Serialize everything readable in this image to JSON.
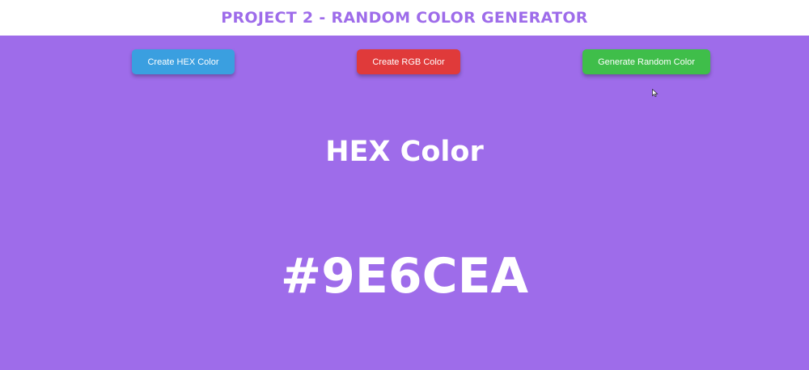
{
  "header": {
    "title": "PROJECT 2 - RANDOM COLOR GENERATOR"
  },
  "colors": {
    "background": "#9E6CEA",
    "header_bg": "#FFFFFF",
    "title_text": "#9E6CEA",
    "hex_button": "#3A9FE0",
    "rgb_button": "#E03A3A",
    "random_button": "#3FBE4A"
  },
  "buttons": {
    "hex_label": "Create HEX Color",
    "rgb_label": "Create RGB Color",
    "random_label": "Generate Random Color"
  },
  "display": {
    "mode_title": "HEX Color",
    "color_value": "#9E6CEA"
  },
  "icons": {
    "cursor": "mouse-pointer-icon"
  }
}
